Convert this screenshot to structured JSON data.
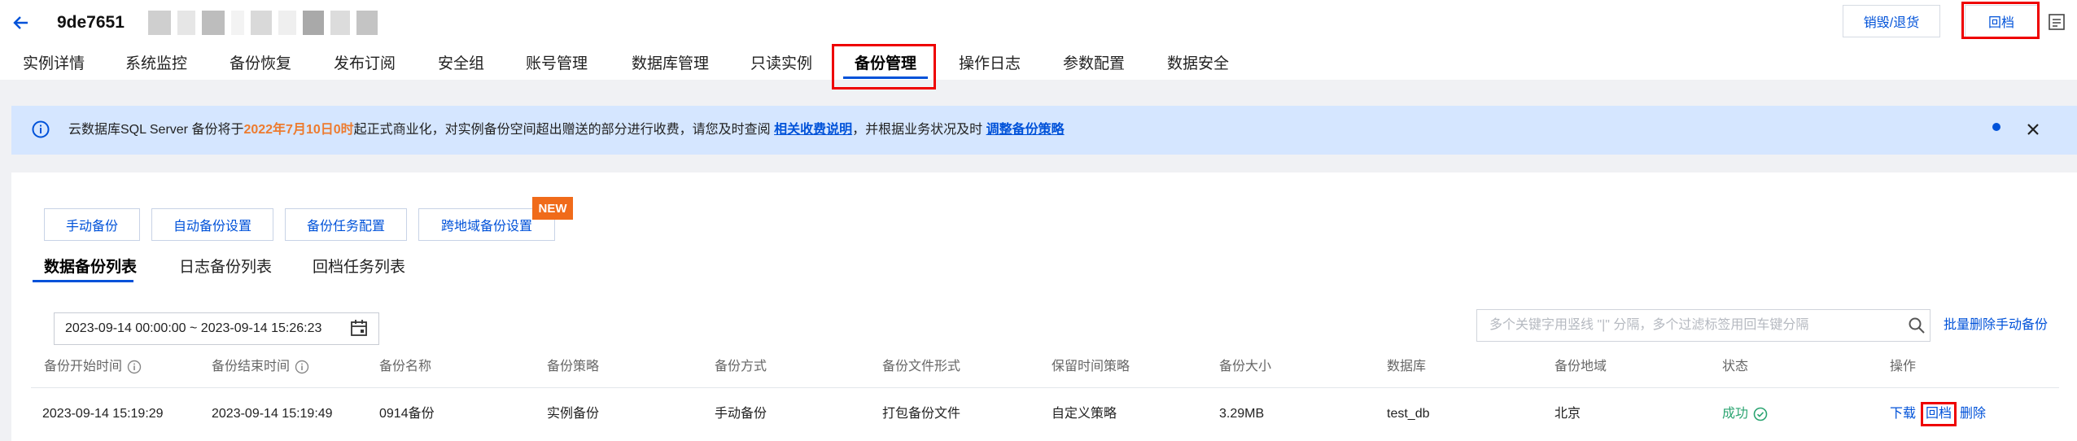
{
  "header": {
    "title": "9de7651",
    "btn_return": "销毁/退货",
    "btn_rollback": "回档",
    "accent": "#0052d9"
  },
  "tabs": [
    {
      "label": "实例详情"
    },
    {
      "label": "系统监控"
    },
    {
      "label": "备份恢复"
    },
    {
      "label": "发布订阅"
    },
    {
      "label": "安全组"
    },
    {
      "label": "账号管理"
    },
    {
      "label": "数据库管理"
    },
    {
      "label": "只读实例"
    },
    {
      "label": "备份管理",
      "active": true
    },
    {
      "label": "操作日志"
    },
    {
      "label": "参数配置"
    },
    {
      "label": "数据安全"
    }
  ],
  "banner": {
    "t1": "云数据库SQL Server 备份将于",
    "t2": "2022年7月10日0时",
    "t3": "起正式商业化，对实例备份空间超出赠送的部分进行收费，请您及时查阅 ",
    "link1": "相关收费说明",
    "t4": "，并根据业务状况及时 ",
    "link2": "调整备份策略",
    "bg": "#d5e6ff"
  },
  "actions": {
    "manual_backup": "手动备份",
    "auto_backup": "自动备份设置",
    "task_config": "备份任务配置",
    "cross_region": "跨地域备份设置",
    "new_badge": "NEW"
  },
  "subtabs": {
    "data_list": "数据备份列表",
    "log_list": "日志备份列表",
    "rollback_list": "回档任务列表"
  },
  "filter": {
    "date_range": "2023-09-14 00:00:00 ~ 2023-09-14 15:26:23",
    "search_placeholder": "多个关键字用竖线 \"|\" 分隔，多个过滤标签用回车键分隔",
    "batch_delete": "批量删除手动备份"
  },
  "table": {
    "headers": [
      "备份开始时间",
      "备份结束时间",
      "备份名称",
      "备份策略",
      "备份方式",
      "备份文件形式",
      "保留时间策略",
      "备份大小",
      "数据库",
      "备份地域",
      "状态",
      "操作"
    ],
    "row": {
      "start": "2023-09-14 15:19:29",
      "end": "2023-09-14 15:19:49",
      "name": "0914备份",
      "strategy": "实例备份",
      "method": "手动备份",
      "file_form": "打包备份文件",
      "retention": "自定义策略",
      "size": "3.29MB",
      "db": "test_db",
      "region": "北京",
      "status": "成功",
      "op_download": "下载",
      "op_rollback": "回档",
      "op_delete": "删除"
    }
  }
}
